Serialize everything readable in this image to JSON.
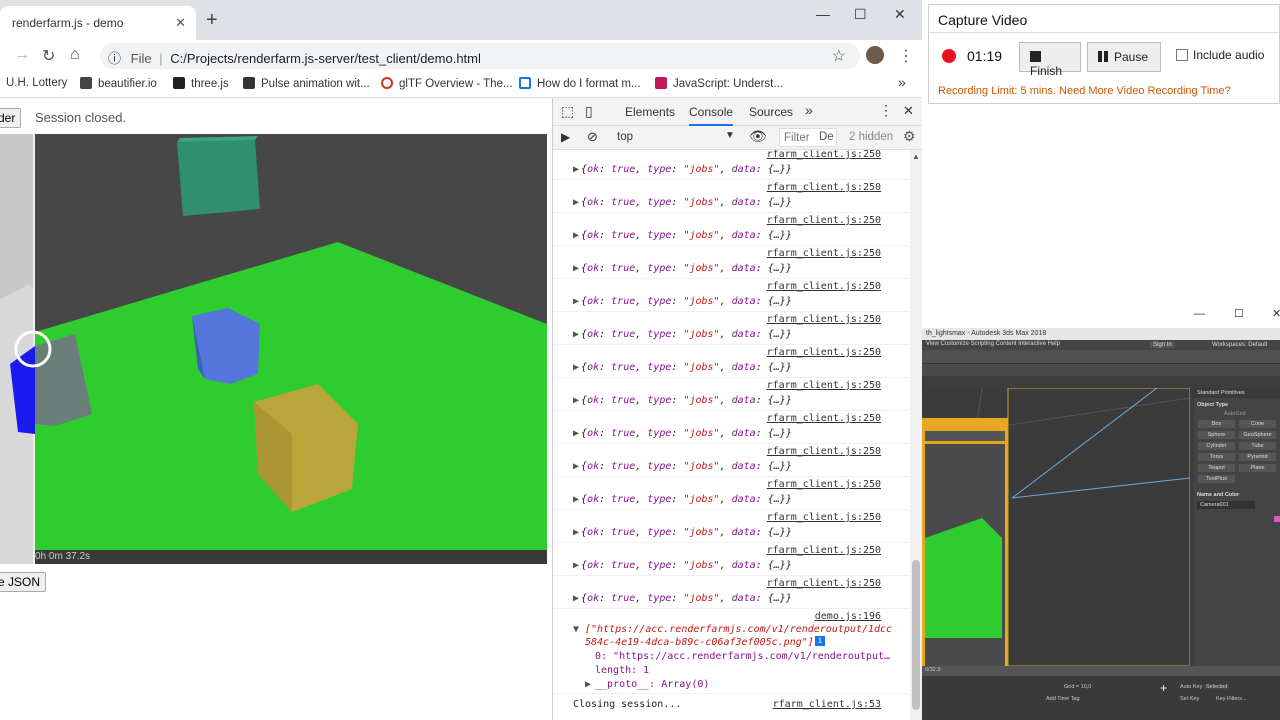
{
  "browser": {
    "tab_title": "renderfarm.js - demo",
    "tab_close": "✕",
    "new_tab": "+",
    "win_min": "—",
    "win_max": "☐",
    "win_close": "✕",
    "nav_forward": "→",
    "nav_reload": "↻",
    "nav_home": "⌂",
    "info_icon": "ⓘ",
    "url_scheme": "File",
    "url": "C:/Projects/renderfarm.js-server/test_client/demo.html",
    "bookmark_star": "☆",
    "menu": "⋮",
    "bookmarks": [
      {
        "label": "U.H. Lottery",
        "color": "#777777"
      },
      {
        "label": "beautifier.io",
        "color": "#444444"
      },
      {
        "label": "three.js",
        "color": "#222222"
      },
      {
        "label": "Pulse animation wit...",
        "color": "#333333"
      },
      {
        "label": "glTF Overview - The...",
        "color": "#d93025"
      },
      {
        "label": "How do I format m...",
        "color": "#1a73e8"
      },
      {
        "label": "JavaScript: Underst...",
        "color": "#c2185b"
      }
    ],
    "bookmarks_more": "»"
  },
  "page": {
    "render_button": "der",
    "status": "Session closed.",
    "json_button": "e JSON",
    "render_time": "0h  0m 37.2s"
  },
  "devtools": {
    "tabs": [
      "Elements",
      "Console",
      "Sources"
    ],
    "active_tab": "Console",
    "more_tabs": "»",
    "context": "top",
    "filter_placeholder": "Filter",
    "level": "De",
    "hidden_count": "2 hidden",
    "close": "✕",
    "menu": "⋮",
    "log_entries_count": 14,
    "log_source": "rfarm_client.js:250",
    "log_message_parts": {
      "ok_key": "ok",
      "ok_val": "true",
      "type_key": "type",
      "type_val": "\"jobs\"",
      "data_key": "data",
      "data_val": "{…}"
    },
    "array_source": "demo.js:196",
    "array_line1": "[\"https://acc.renderfarmjs.com/v1/renderoutput/1dcc",
    "array_line2": "584c-4e19-4dca-b89c-c06af3ef005c.png\"]",
    "array_item": "0: \"https://acc.renderfarmjs.com/v1/renderoutput…",
    "array_length": "length: 1",
    "array_proto": "__proto__: Array(0)",
    "closing_message": "Closing session...",
    "closing_source": "rfarm_client.js:53"
  },
  "capture": {
    "title": "Capture Video",
    "time": "01:19",
    "finish": "Finish",
    "pause": "Pause",
    "include_audio": "Include audio",
    "note": "Recording Limit: 5 mins. Need More Video Recording Time?"
  },
  "max": {
    "title": "th_lightsmax - Autodesk 3ds Max 2018",
    "menu": "View   Customize   Scripting   Content   Interactive   Help",
    "sign_in": "Sign In",
    "workspaces": "Workspaces:  Default",
    "panel_title": "Standard Primitives",
    "object_type": "Object Type",
    "autogrid": "AutoGrid",
    "primitives": [
      "Box",
      "Cone",
      "Sphere",
      "GeoSphere",
      "Cylinder",
      "Tube",
      "Torus",
      "Pyramid",
      "Teapot",
      "Plane",
      "TextPlus"
    ],
    "name_color": "Name and Color",
    "camera_name": "Camera001",
    "grid_label": "Grid = 10,0",
    "auto_key": "Auto Key",
    "set_key": "Set Key",
    "selected": "Selected",
    "key_filters": "Key Filters...",
    "add_time_tag": "Add Time Tag",
    "frame": "0/32.3"
  },
  "colors": {
    "ground": "#2ecc2e",
    "sky": "#474747",
    "cube_teal": "#2f8f6f",
    "cube_blue": "#5577dd",
    "cube_yellow": "#b9a63a",
    "recording_red": "#e81123",
    "note_orange": "#d35400"
  }
}
